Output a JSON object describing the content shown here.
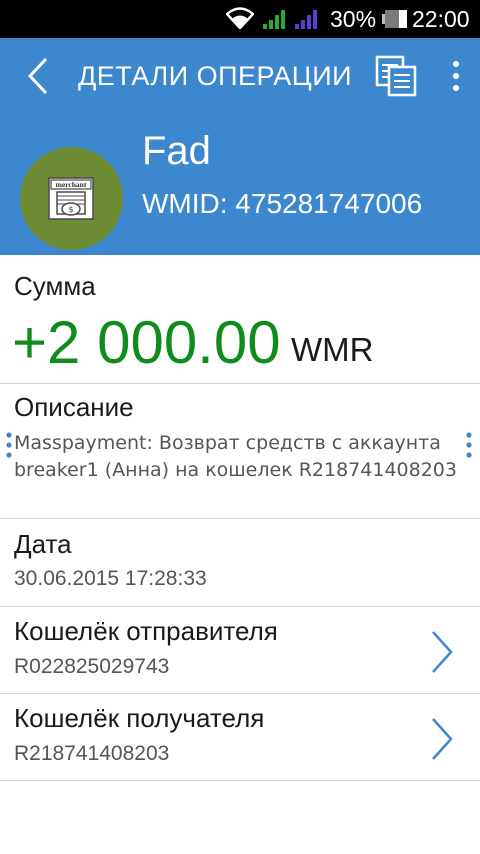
{
  "status_bar": {
    "battery_percent": "30%",
    "time": "22:00",
    "icons": [
      "wifi-icon",
      "signal-icon",
      "signal-icon",
      "battery-icon"
    ],
    "signal_colors": [
      "#2fa82f",
      "#5a3fd1"
    ]
  },
  "header": {
    "title": "ДЕТАЛИ ОПЕРАЦИИ",
    "background": "#3d87cf",
    "account_name": "Fad",
    "wmid": "WMID: 475281747006",
    "avatar_color": "#6d8b33",
    "avatar_icon": "merchant-icon",
    "avatar_icon_text": "merchant"
  },
  "amount": {
    "label": "Сумма",
    "value": "+2 000.00",
    "currency": "WMR",
    "color": "#108c1c"
  },
  "description": {
    "label": "Описание",
    "text": "Masspayment: Возврат средств с аккаунта breaker1 (Анна) на кошелек R218741408203"
  },
  "date": {
    "label": "Дата",
    "value": "30.06.2015 17:28:33"
  },
  "sender_wallet": {
    "label": "Кошелёк отправителя",
    "value": "R022825029743"
  },
  "receiver_wallet": {
    "label": "Кошелёк получателя",
    "value": "R218741408203"
  }
}
